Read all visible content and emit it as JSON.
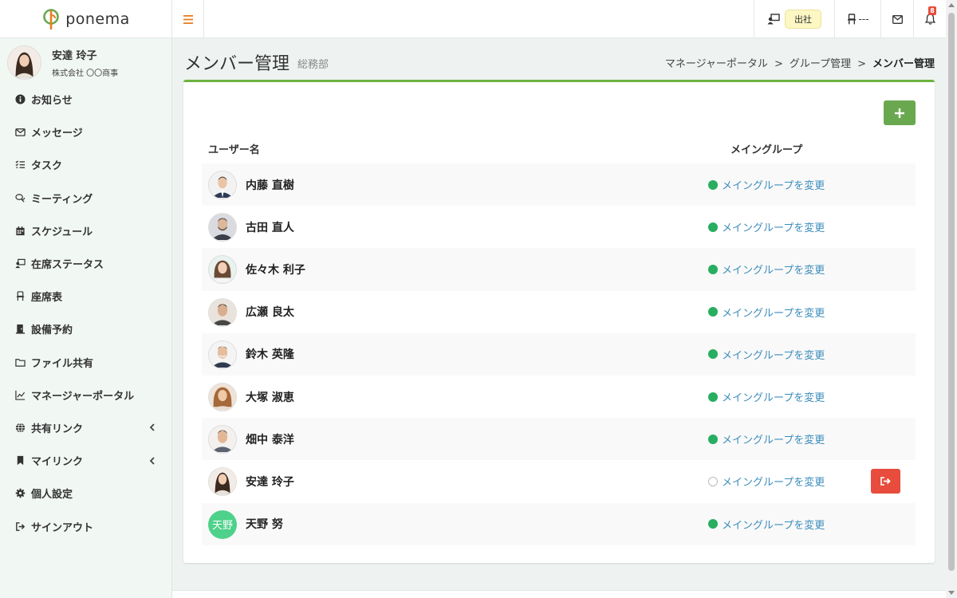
{
  "brand": {
    "name": "ponema",
    "color": "#6aa84f"
  },
  "user": {
    "name": "安達 玲子",
    "company": "株式会社 〇〇商事"
  },
  "sidebar": {
    "items": [
      {
        "label": "お知らせ",
        "icon": "info-icon"
      },
      {
        "label": "メッセージ",
        "icon": "envelope-icon"
      },
      {
        "label": "タスク",
        "icon": "tasks-icon"
      },
      {
        "label": "ミーティング",
        "icon": "chat-icon"
      },
      {
        "label": "スケジュール",
        "icon": "calendar-icon"
      },
      {
        "label": "在席ステータス",
        "icon": "presence-icon"
      },
      {
        "label": "座席表",
        "icon": "chair-icon"
      },
      {
        "label": "設備予約",
        "icon": "door-icon"
      },
      {
        "label": "ファイル共有",
        "icon": "folder-icon"
      },
      {
        "label": "マネージャーポータル",
        "icon": "chart-icon"
      },
      {
        "label": "共有リンク",
        "icon": "globe-icon"
      },
      {
        "label": "マイリンク",
        "icon": "bookmark-icon"
      },
      {
        "label": "個人設定",
        "icon": "gear-icon"
      },
      {
        "label": "サインアウト",
        "icon": "signout-icon"
      }
    ]
  },
  "topbar": {
    "status_label": "出社",
    "seat_label": "---",
    "notification_count": "8"
  },
  "page": {
    "title": "メンバー管理",
    "subtitle": "総務部",
    "breadcrumb": [
      "マネージャーポータル",
      "グループ管理",
      "メンバー管理"
    ],
    "breadcrumb_sep": ">"
  },
  "table": {
    "headers": {
      "user": "ユーザー名",
      "group": "メイングループ"
    },
    "change_link": "メイングループを変更",
    "rows": [
      {
        "name": "内藤 直樹",
        "main_group": true
      },
      {
        "name": "古田 直人",
        "main_group": true
      },
      {
        "name": "佐々木 利子",
        "main_group": true
      },
      {
        "name": "広瀬 良太",
        "main_group": true
      },
      {
        "name": "鈴木 英隆",
        "main_group": true
      },
      {
        "name": "大塚 淑恵",
        "main_group": true
      },
      {
        "name": "畑中 泰洋",
        "main_group": true
      },
      {
        "name": "安達 玲子",
        "main_group": false
      },
      {
        "name": "天野 努",
        "main_group": true,
        "avatar_text": "天野"
      }
    ]
  },
  "colors": {
    "accent_green": "#6aa84f",
    "dot_green": "#27ae60",
    "danger_red": "#e74c3c",
    "link_blue": "#3c8dbc",
    "badge_yellow": "#fdf7c3"
  }
}
